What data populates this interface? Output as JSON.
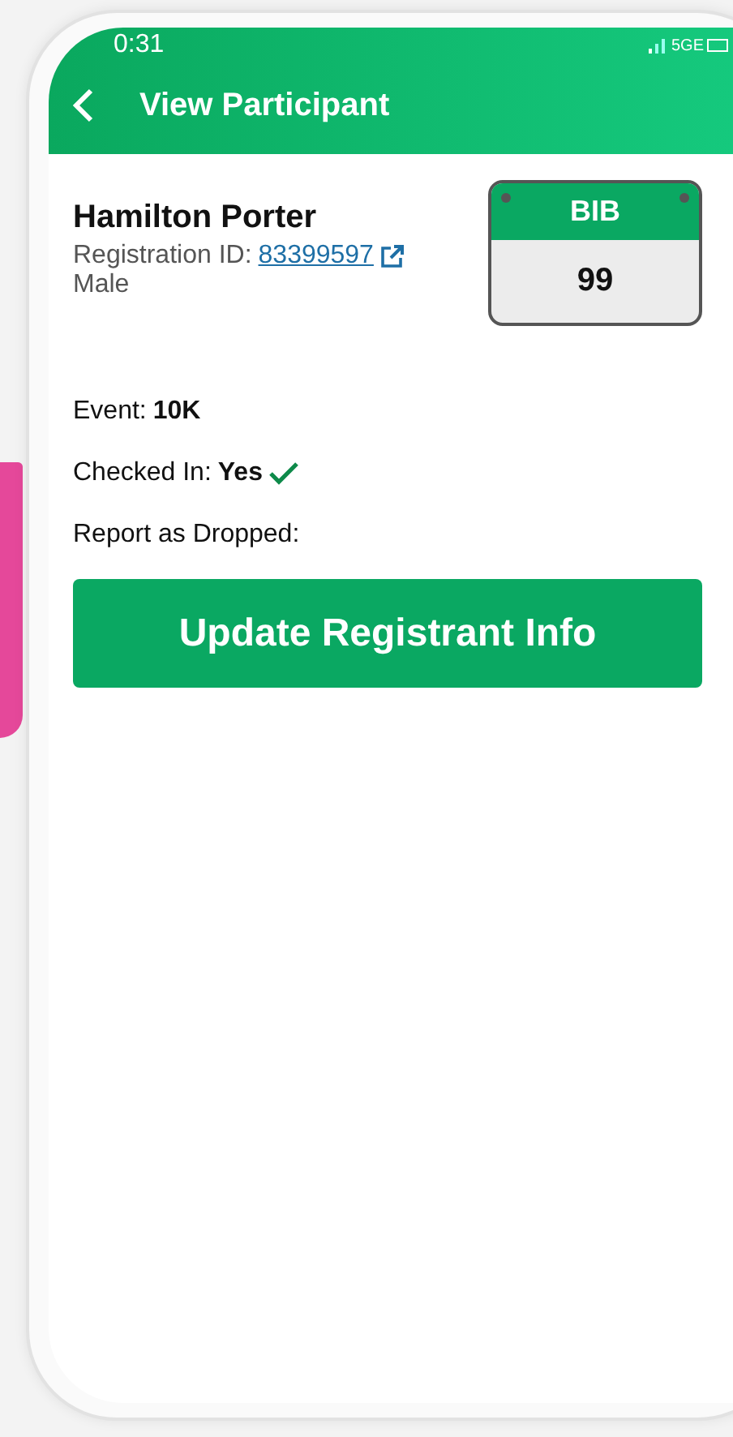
{
  "status_bar": {
    "time": "0:31",
    "network": "5GE"
  },
  "header": {
    "title": "View Participant"
  },
  "participant": {
    "name": "Hamilton Porter",
    "registration_label": "Registration ID:",
    "registration_id": "83399597",
    "gender": "Male"
  },
  "bib": {
    "label": "BIB",
    "number": "99"
  },
  "fields": [
    {
      "label": "Event:",
      "value": "10K",
      "kind": "text"
    },
    {
      "label": "Checked In:",
      "value": "Yes",
      "kind": "check"
    },
    {
      "label": "Report as Dropped:",
      "kind": "text"
    }
  ],
  "button": {
    "label": "Update Registrant Info"
  }
}
